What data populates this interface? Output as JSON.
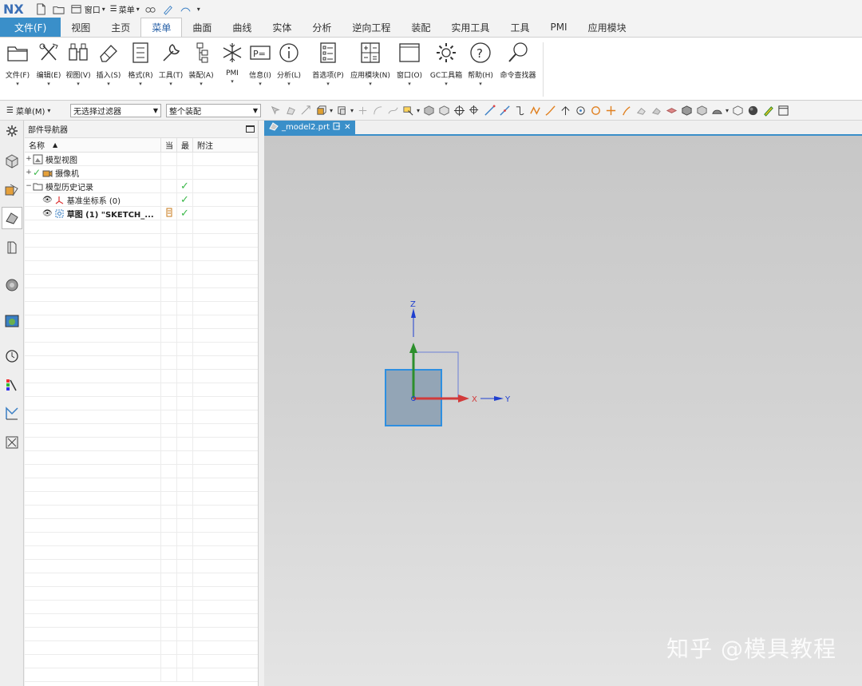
{
  "app": {
    "logo": "NX",
    "quick_window_label": "窗口",
    "quick_menu_label": "菜单"
  },
  "tabs": [
    {
      "label": "文件(F)"
    },
    {
      "label": "视图"
    },
    {
      "label": "主页"
    },
    {
      "label": "菜单"
    },
    {
      "label": "曲面"
    },
    {
      "label": "曲线"
    },
    {
      "label": "实体"
    },
    {
      "label": "分析"
    },
    {
      "label": "逆向工程"
    },
    {
      "label": "装配"
    },
    {
      "label": "实用工具"
    },
    {
      "label": "工具"
    },
    {
      "label": "PMI"
    },
    {
      "label": "应用模块"
    }
  ],
  "ribbon": [
    {
      "label": "文件(F)",
      "icon": "folder-icon"
    },
    {
      "label": "编辑(E)",
      "icon": "edit-tools-icon"
    },
    {
      "label": "视图(V)",
      "icon": "binoculars-icon"
    },
    {
      "label": "插入(S)",
      "icon": "eraser-icon"
    },
    {
      "label": "格式(R)",
      "icon": "format-list-icon"
    },
    {
      "label": "工具(T)",
      "icon": "wrench-icon"
    },
    {
      "label": "装配(A)",
      "icon": "assembly-icon"
    },
    {
      "label": "PMI",
      "icon": "snowflake-icon"
    },
    {
      "label": "信息(I)",
      "icon": "p-equals-icon"
    },
    {
      "label": "分析(L)",
      "icon": "info-icon"
    },
    {
      "label": "首选项(P)",
      "icon": "preferences-icon"
    },
    {
      "label": "应用模块(N)",
      "icon": "app-module-icon"
    },
    {
      "label": "窗口(O)",
      "icon": "window-icon"
    },
    {
      "label": "GC工具箱",
      "icon": "gear-icon"
    },
    {
      "label": "帮助(H)",
      "icon": "help-icon"
    },
    {
      "label": "命令查找器",
      "icon": "search-icon"
    }
  ],
  "selbar": {
    "menu_label": "菜单(M)",
    "filter_value": "无选择过滤器",
    "scope_value": "整个装配"
  },
  "navigator": {
    "title": "部件导航器",
    "columns": {
      "name": "名称",
      "current": "当",
      "latest": "最",
      "note": "附注"
    },
    "rows": [
      {
        "name": "模型视图",
        "expander": "+",
        "check_current": false,
        "check_latest": false,
        "bold": false
      },
      {
        "name": "摄像机",
        "expander": "+",
        "check_current": false,
        "check_latest": false,
        "bold": false
      },
      {
        "name": "模型历史记录",
        "expander": "−",
        "check_current": false,
        "check_latest": true,
        "bold": false
      },
      {
        "name": "基准坐标系 (0)",
        "expander": "",
        "check_current": false,
        "check_latest": true,
        "bold": false
      },
      {
        "name": "草图 (1) \"SKETCH_...",
        "expander": "",
        "check_current": false,
        "check_latest": true,
        "bold": true
      }
    ]
  },
  "graphics": {
    "tab_label": "_model2.prt",
    "axis_z": "Z",
    "axis_x": "X",
    "axis_y": "Y"
  },
  "watermark": "知乎 @模具教程",
  "colors": {
    "file_tab": "#3a8fc9",
    "active_tab_text": "#2a62a8",
    "check_green": "#3cb84a",
    "axis_x": "#d23a3a",
    "axis_y": "#1f3fcf",
    "axis_z": "#2c8f2c"
  }
}
